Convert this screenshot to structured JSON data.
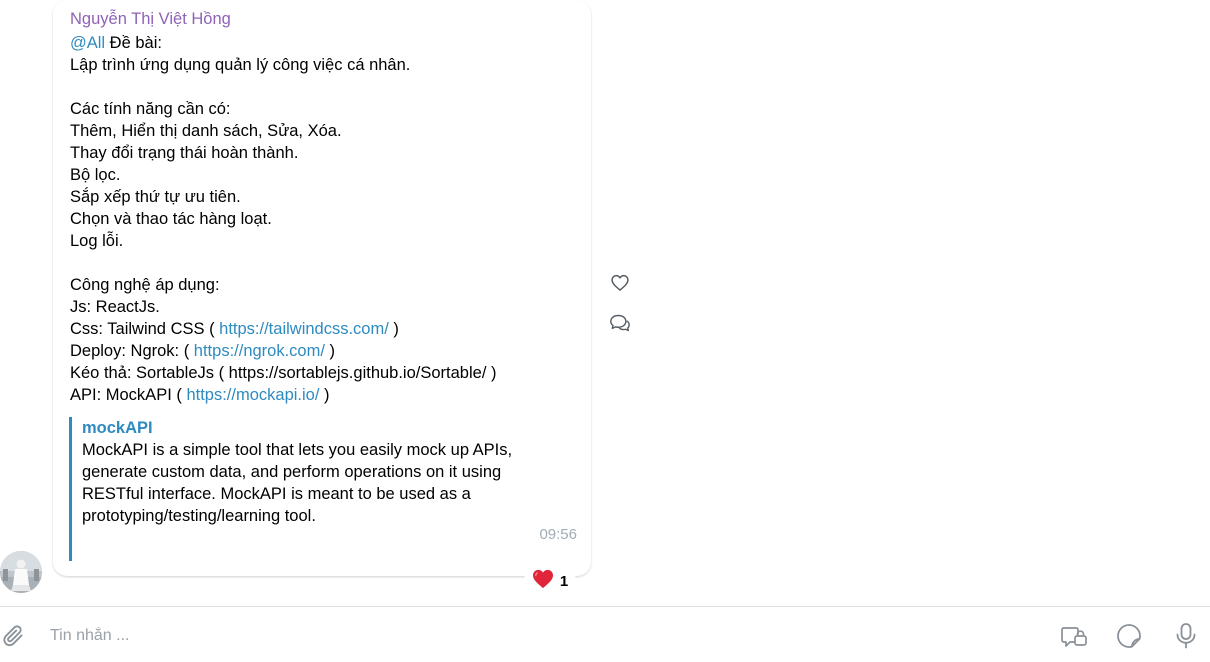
{
  "message": {
    "sender": "Nguyễn Thị Việt Hồng",
    "mention": "@All",
    "line1_rest": " Đề bài:",
    "line2": "Lập trình ứng dụng quản lý công việc cá nhân.",
    "features_heading": "Các tính năng cần có:",
    "features": [
      "Thêm, Hiển thị danh sách, Sửa, Xóa.",
      "Thay đổi trạng thái hoàn thành.",
      "Bộ lọc.",
      "Sắp xếp thứ tự ưu tiên.",
      "Chọn và thao tác hàng loạt.",
      "Log lỗi."
    ],
    "tech_heading": "Công nghệ áp dụng:",
    "tech": {
      "js": "Js: ReactJs.",
      "css_prefix": "Css: Tailwind CSS ( ",
      "css_link": "https://tailwindcss.com/",
      "css_suffix": " )",
      "deploy_prefix": "Deploy: Ngrok: ( ",
      "deploy_link": "https://ngrok.com/",
      "deploy_suffix": " )",
      "dnd": "Kéo thả: SortableJs ( https://sortablejs.github.io/Sortable/ )",
      "api_prefix": "API: MockAPI ( ",
      "api_link": "https://mockapi.io/",
      "api_suffix": " )"
    },
    "preview": {
      "title": "mockAPI",
      "description_lines": [
        "MockAPI is a simple tool that lets you easily mock up APIs,",
        "generate custom data, and perform operations on it using",
        "RESTful interface. MockAPI is meant to be used as a",
        "prototyping/testing/learning tool."
      ]
    },
    "time": "09:56",
    "reaction": {
      "emoji": "❤️",
      "count": "1"
    }
  },
  "side_actions": {
    "like_icon": "heart-icon",
    "reply_icon": "comment-icon"
  },
  "composer": {
    "placeholder": "Tin nhắn ...",
    "icons": [
      "paperclip-icon",
      "quick-message-icon",
      "sticker-icon",
      "microphone-icon"
    ]
  },
  "colors": {
    "sender": "#8e62b8",
    "link": "#2e8bc0",
    "time": "#a0acb6",
    "reaction_heart": "#e0243a"
  }
}
